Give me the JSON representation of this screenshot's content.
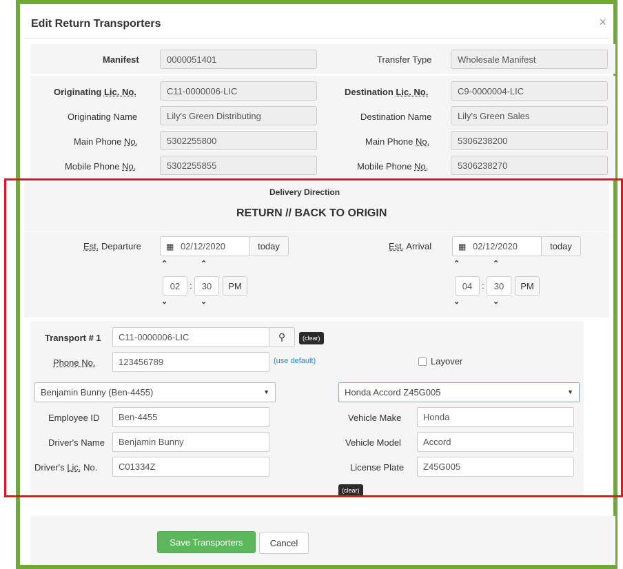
{
  "modal": {
    "title": "Edit Return Transporters",
    "close_symbol": "×"
  },
  "manifest": {
    "manifest_label": "Manifest",
    "manifest_value": "0000051401",
    "transfer_type_label": "Transfer Type",
    "transfer_type_value": "Wholesale Manifest"
  },
  "origin": {
    "lic_label_a": "Originating ",
    "lic_label_b": "Lic. No.",
    "lic_value": "C11-0000006-LIC",
    "name_label": "Originating Name",
    "name_value": "Lily's Green Distributing",
    "main_phone_label_a": "Main Phone ",
    "main_phone_label_b": "No.",
    "main_phone_value": "5302255800",
    "mobile_phone_label_a": "Mobile Phone ",
    "mobile_phone_label_b": "No.",
    "mobile_phone_value": "5302255855"
  },
  "destination": {
    "lic_label_a": "Destination ",
    "lic_label_b": "Lic. No.",
    "lic_value": "C9-0000004-LIC",
    "name_label": "Destination Name",
    "name_value": "Lily's Green Sales",
    "main_phone_label_a": "Main Phone ",
    "main_phone_label_b": "No.",
    "main_phone_value": "5306238200",
    "mobile_phone_label_a": "Mobile Phone ",
    "mobile_phone_label_b": "No.",
    "mobile_phone_value": "5306238270"
  },
  "delivery": {
    "label": "Delivery Direction",
    "value": "RETURN // BACK TO ORIGIN"
  },
  "departure": {
    "label_a": "Est.",
    "label_b": " Departure",
    "date": "02/12/2020",
    "today": "today",
    "hour": "02",
    "minute": "30",
    "ampm": "PM",
    "sep": ":"
  },
  "arrival": {
    "label_a": "Est.",
    "label_b": " Arrival",
    "date": "02/12/2020",
    "today": "today",
    "hour": "04",
    "minute": "30",
    "ampm": "PM",
    "sep": ":"
  },
  "icons": {
    "calendar": "▦",
    "chev_up": "⌃",
    "chev_down": "⌄",
    "search": "⚲",
    "caret": "▼"
  },
  "transport": {
    "label": "Transport # 1",
    "license": "C11-0000006-LIC",
    "clear": "(clear)",
    "phone_label": "Phone No.",
    "phone_value": "123456789",
    "use_default": "(use default)",
    "layover": "Layover",
    "driver_select": "Benjamin Bunny (Ben-4455)",
    "vehicle_select": "Honda Accord Z45G005",
    "employee_id_label": "Employee ID",
    "employee_id_value": "Ben-4455",
    "driver_name_label": "Driver's Name",
    "driver_name_value": "Benjamin Bunny",
    "driver_lic_label_a": "Driver's ",
    "driver_lic_label_b": "Lic.",
    "driver_lic_label_c": " No.",
    "driver_lic_value": "C01334Z",
    "vehicle_make_label": "Vehicle Make",
    "vehicle_make_value": "Honda",
    "vehicle_model_label": "Vehicle Model",
    "vehicle_model_value": "Accord",
    "license_plate_label": "License Plate",
    "license_plate_value": "Z45G005",
    "vehicle_clear": "(clear)"
  },
  "footer": {
    "save": "Save Transporters",
    "cancel": "Cancel"
  },
  "colors": {
    "frame": "#71a83c",
    "highlight": "#e8141b",
    "save_button": "#5cb85c"
  }
}
